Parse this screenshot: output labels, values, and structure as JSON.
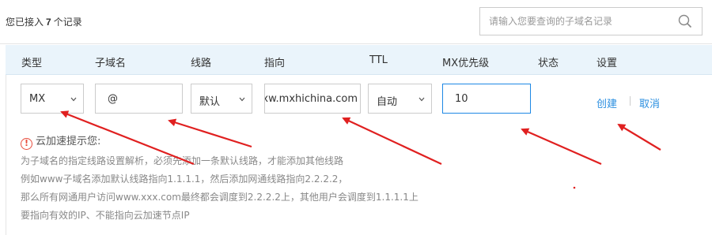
{
  "summary": {
    "prefix": "您已接入",
    "count": "7",
    "suffix": "个记录"
  },
  "search": {
    "placeholder": "请输入您要查询的子域名记录",
    "icon": "search-icon"
  },
  "table_headers": [
    "类型",
    "子域名",
    "线路",
    "指向",
    "TTL",
    "MX优先级",
    "状态",
    "设置"
  ],
  "row": {
    "type": "MX",
    "subdomain": "@",
    "line": "默认",
    "target": "xw.mxhichina.com",
    "ttl": "自动",
    "mx_priority": "10"
  },
  "actions": {
    "create": "创建",
    "cancel": "取消"
  },
  "tip": {
    "title": "云加速提示您:",
    "lines": [
      "为子域名的指定线路设置解析，必须先添加一条默认线路，才能添加其他线路",
      "例如www子域名添加默认线路指向1.1.1.1，然后添加网通线路指向2.2.2.2，",
      "那么所有网通用户访问www.xxx.com最终都会调度到2.2.2.2上，其他用户会调度到1.1.1.1上",
      "要指向有效的IP、不能指向云加速节点IP"
    ]
  },
  "colors": {
    "accent": "#2b8fe0",
    "header_bg": "#eaf4fb",
    "arrow": "#e02020",
    "warning": "#e84d3d"
  }
}
